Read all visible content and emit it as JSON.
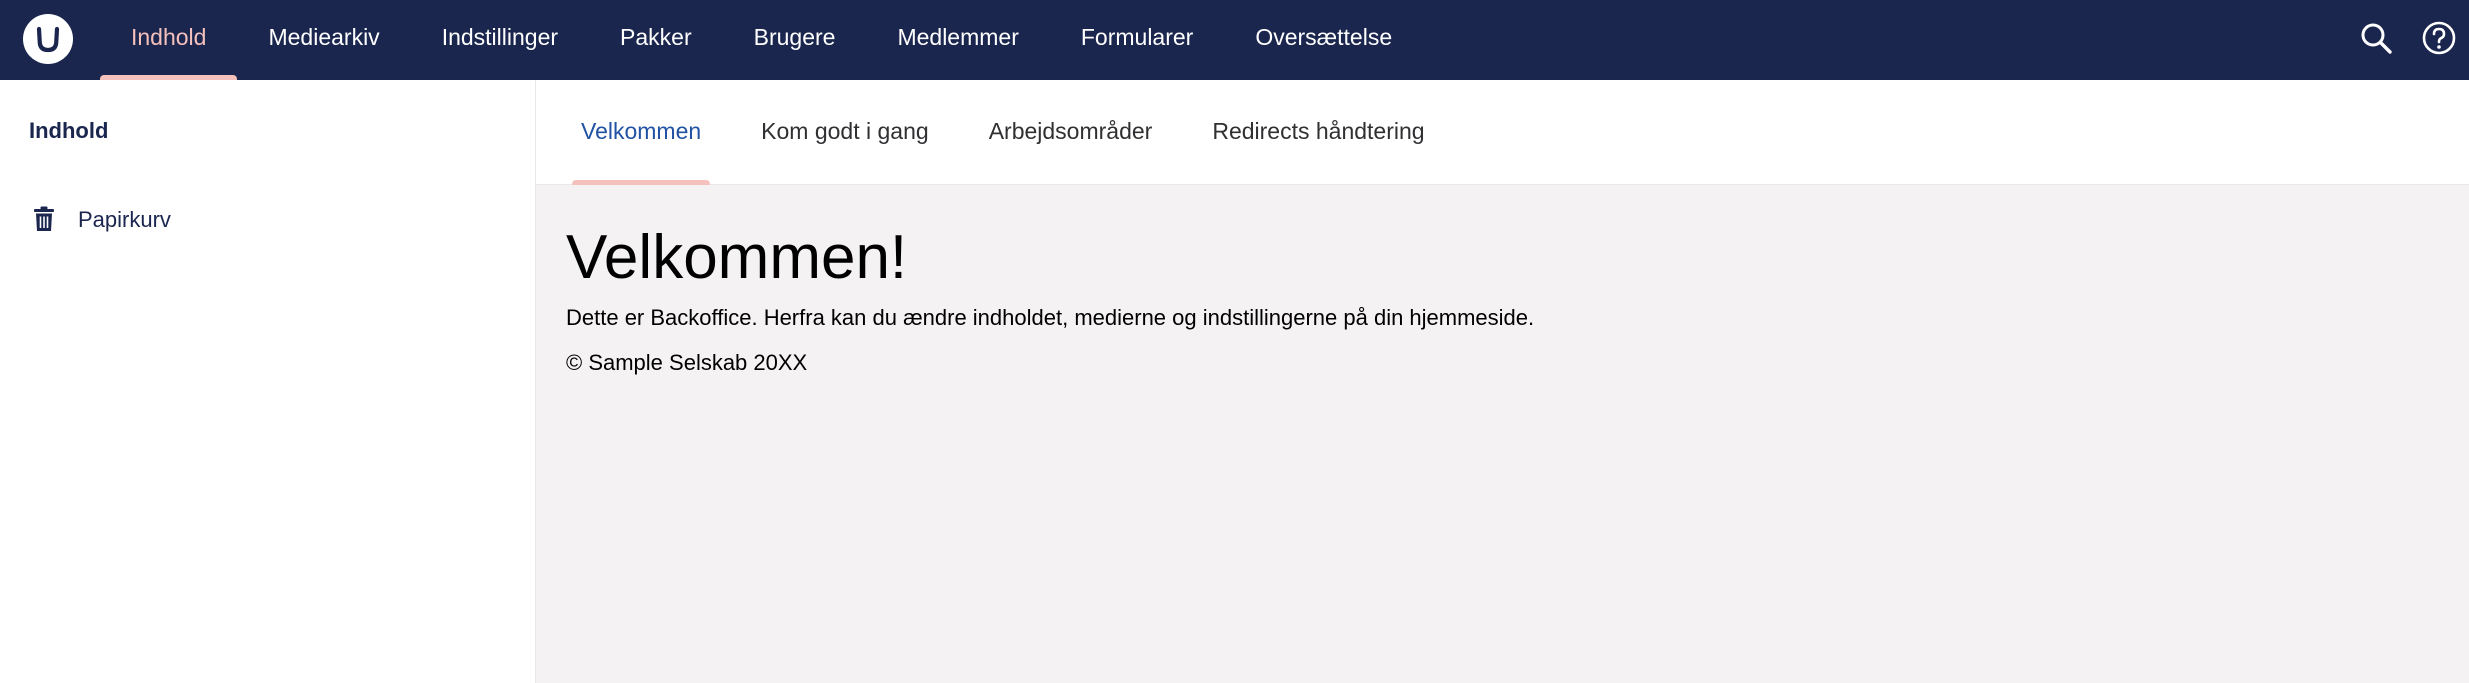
{
  "header": {
    "logo_icon": "umbraco-logo-icon",
    "sections": [
      {
        "label": "Indhold",
        "active": true
      },
      {
        "label": "Mediearkiv",
        "active": false
      },
      {
        "label": "Indstillinger",
        "active": false
      },
      {
        "label": "Pakker",
        "active": false
      },
      {
        "label": "Brugere",
        "active": false
      },
      {
        "label": "Medlemmer",
        "active": false
      },
      {
        "label": "Formularer",
        "active": false
      },
      {
        "label": "Oversættelse",
        "active": false
      }
    ],
    "tools": [
      "search-icon",
      "help-icon"
    ]
  },
  "sidebar": {
    "title": "Indhold",
    "items": [
      {
        "label": "Papirkurv",
        "icon": "trash-icon"
      }
    ]
  },
  "main": {
    "tabs": [
      {
        "label": "Velkommen",
        "active": true
      },
      {
        "label": "Kom godt i gang",
        "active": false
      },
      {
        "label": "Arbejdsområder",
        "active": false
      },
      {
        "label": "Redirects håndtering",
        "active": false
      }
    ],
    "heading": "Velkommen!",
    "text": "Dette er Backoffice. Herfra kan du ændre indholdet, medierne og indstillingerne på din hjemmeside.",
    "copyright": "© Sample Selskab 20XX"
  },
  "colors": {
    "topbar": "#1b264f",
    "active_section": "#f5c1bc",
    "active_tab": "#2152a3",
    "content_bg": "#f4f2f3"
  }
}
